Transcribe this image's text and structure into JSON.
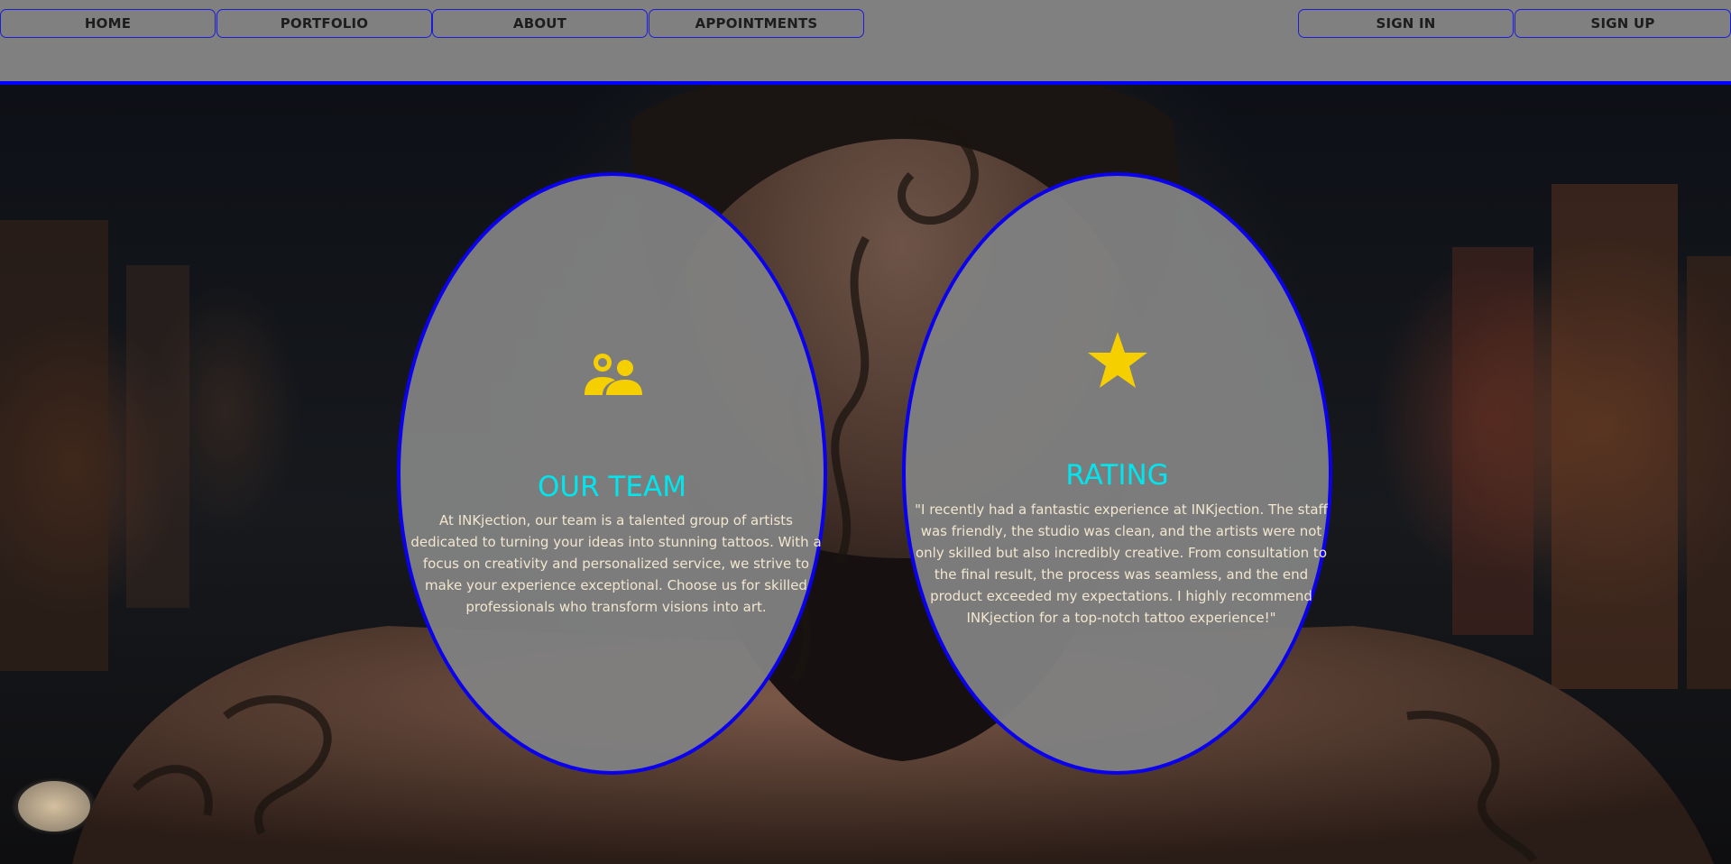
{
  "nav": {
    "left": [
      "HOME",
      "PORTFOLIO",
      "ABOUT",
      "APPOINTMENTS"
    ],
    "right": [
      "SIGN IN",
      "SIGN UP"
    ]
  },
  "cards": {
    "team": {
      "icon": "team-icon",
      "title": "OUR TEAM",
      "text": "At INKjection, our team is a talented group of artists dedicated to turning your ideas into stunning tattoos. With a focus on creativity and personalized service, we strive to make your experience exceptional. Choose us for skilled professionals who transform visions into art."
    },
    "rating": {
      "icon": "star-icon",
      "title": "RATING",
      "text": "\"I recently had a fantastic experience at INKjection. The staff was friendly, the studio was clean, and the artists were not only skilled but also incredibly creative. From consultation to the final result, the process was seamless, and the end product exceeded my expectations. I highly recommend INKjection for a top-notch tattoo experience!\""
    }
  },
  "colors": {
    "accent": "#0000ff",
    "heading": "#00e5ee",
    "icon": "#f5cf00",
    "body_text": "#f2e6cf",
    "panel": "#808080"
  }
}
